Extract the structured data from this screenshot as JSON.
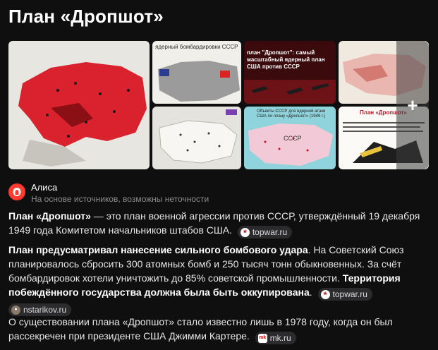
{
  "page": {
    "title": "План «Дропшот»"
  },
  "gallery": {
    "more_label": "+",
    "tiles": [
      {
        "caption": ""
      },
      {
        "caption": "ядерный бомбардировки СССР"
      },
      {
        "caption": "план \"Дропшот\": самый масштабный ядерный план США против СССР"
      },
      {
        "caption": ""
      },
      {
        "caption": ""
      },
      {
        "caption": "Объекты СССР для ядерной атаки США по плану «Дропшот» (1949 г.)",
        "map_label": "СССР"
      },
      {
        "caption": "План «Дропшот»"
      }
    ]
  },
  "alice": {
    "name": "Алиса",
    "disclaimer": "На основе источников, возможны неточности"
  },
  "answer": {
    "p1": {
      "lead": "План «Дропшот»",
      "text": " — это план военной агрессии против СССР, утверждённый 19 декабря 1949 года Комитетом начальников штабов США.",
      "source": "topwar.ru"
    },
    "p2": {
      "lead": "План предусматривал нанесение сильного бомбового удара",
      "text": ". На Советский Союз планировалось сбросить 300 атомных бомб и 250 тысяч тонн обыкновенных. За счёт бомбардировок хотели уничтожить до 85% советской промышленности. ",
      "lead2": "Территория побеждённого государства должна была быть оккупирована",
      "text2": ".",
      "source1": "topwar.ru",
      "source2": "nstarikov.ru"
    },
    "p3": {
      "text": "О существовании плана «Дропшот» стало известно лишь в 1978 году, когда он был рассекречен при президенте США Джимми Картере.",
      "source": "mk.ru"
    }
  },
  "colors": {
    "accent": "#ff3b2f",
    "background": "#0f0f10",
    "map_red": "#d9222e"
  }
}
